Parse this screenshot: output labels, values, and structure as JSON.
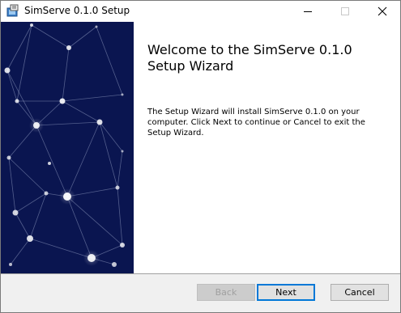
{
  "window": {
    "title": "SimServe 0.1.0 Setup"
  },
  "title_bar": {
    "app_icon": "installer-icon",
    "minimize_icon": "minimize-icon",
    "maximize_icon": "maximize-icon",
    "close_icon": "close-icon"
  },
  "banner": {
    "image": "network-constellation-graphic",
    "background_color": "#0a1550"
  },
  "content": {
    "heading": "Welcome to the SimServe 0.1.0 Setup Wizard",
    "body": "The Setup Wizard will install SimServe 0.1.0 on your computer. Click Next to continue or Cancel to exit the Setup Wizard."
  },
  "buttons": {
    "back": {
      "label": "Back",
      "enabled": false
    },
    "next": {
      "label": "Next",
      "enabled": true,
      "default": true
    },
    "cancel": {
      "label": "Cancel",
      "enabled": true
    }
  },
  "colors": {
    "accent": "#0078d7",
    "banner": "#0a1550",
    "footer": "#f0f0f0"
  }
}
